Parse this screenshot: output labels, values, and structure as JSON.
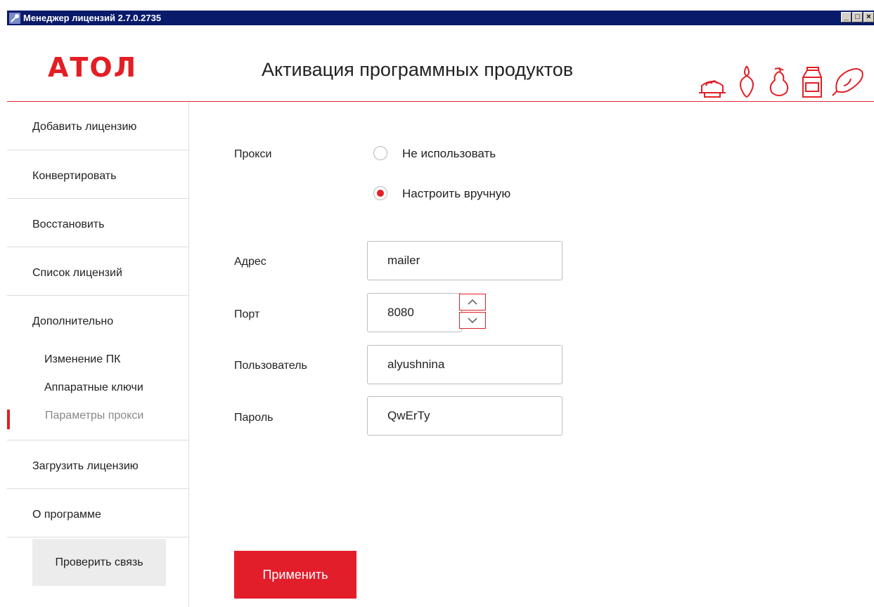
{
  "window": {
    "title": "Менеджер лицензий 2.7.0.2735",
    "buttons": {
      "minimize": "_",
      "maximize": "□",
      "close": "×"
    }
  },
  "header": {
    "logo": "АТОЛ",
    "title": "Активация программных продуктов",
    "decor_icons": [
      "cake-icon",
      "carrot-icon",
      "pear-icon",
      "milk-carton-icon",
      "ham-icon"
    ]
  },
  "sidebar": {
    "items": [
      {
        "label": "Добавить лицензию"
      },
      {
        "label": "Конвертировать"
      },
      {
        "label": "Восстановить"
      },
      {
        "label": "Список лицензий"
      },
      {
        "label": "Дополнительно",
        "subitems": [
          {
            "label": "Изменение ПК"
          },
          {
            "label": "Аппаратные ключи"
          },
          {
            "label": "Параметры прокси",
            "active": true
          }
        ]
      },
      {
        "label": "Загрузить лицензию"
      },
      {
        "label": "О программе"
      }
    ],
    "check_button": "Проверить связь"
  },
  "form": {
    "proxy_label": "Прокси",
    "proxy_options": [
      {
        "label": "Не использовать",
        "checked": false
      },
      {
        "label": "Настроить вручную",
        "checked": true
      }
    ],
    "address": {
      "label": "Адрес",
      "value": "mailer"
    },
    "port": {
      "label": "Порт",
      "value": "8080"
    },
    "user": {
      "label": "Пользователь",
      "value": "alyushnina"
    },
    "password": {
      "label": "Пароль",
      "value": "QwErTy"
    },
    "apply_button": "Применить"
  },
  "colors": {
    "accent": "#e31e24",
    "titlebar": "#0a1a6a",
    "divider": "#dcdcdc"
  }
}
